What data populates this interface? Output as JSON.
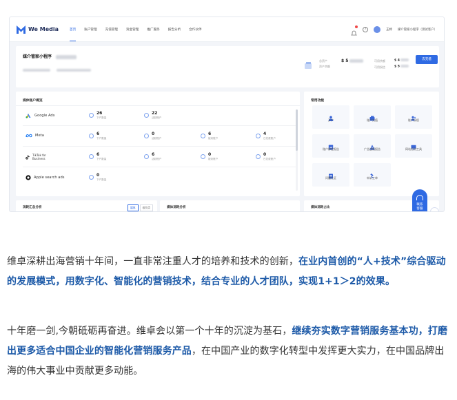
{
  "app": {
    "brand": "We Media",
    "nav": [
      "首页",
      "账户管理",
      "充值管理",
      "资金管理",
      "推广服务",
      "报告分析",
      "合作伙伴"
    ],
    "user_name": "王婷",
    "org_name": "媒介管家小程序（测试客户）"
  },
  "account": {
    "title": "媒介管家小程序",
    "recharge_label": "去充值",
    "balance_labels": [
      "总资产",
      "资产余额",
      "可用余额",
      "可用授信"
    ],
    "balance_values": [
      "$ 5",
      "$ 4",
      "$ 5"
    ]
  },
  "media_overview": {
    "title": "媒体账户概览",
    "rows": [
      {
        "platform": "Google Ads",
        "stats": [
          {
            "num": "26",
            "lbl": "下户数量"
          },
          {
            "num": "22",
            "lbl": "活跃账户"
          }
        ]
      },
      {
        "platform": "Meta",
        "stats": [
          {
            "num": "6",
            "lbl": "下户数量"
          },
          {
            "num": "0",
            "lbl": "活跃账户"
          },
          {
            "num": "6",
            "lbl": "被封账户"
          },
          {
            "num": "4",
            "lbl": "已花费账户"
          }
        ]
      },
      {
        "platform": "TikTok for Business",
        "stats": [
          {
            "num": "6",
            "lbl": "下户数量"
          },
          {
            "num": "6",
            "lbl": "活跃账户"
          },
          {
            "num": "0",
            "lbl": "被封账户"
          },
          {
            "num": "0",
            "lbl": "已花费账户"
          }
        ]
      },
      {
        "platform": "Apple search ads",
        "stats": [
          {
            "num": "0",
            "lbl": "下户数量"
          }
        ]
      }
    ]
  },
  "functions": {
    "title": "常用功能",
    "items": [
      "开户",
      "账户充值",
      "账户授权",
      "账户绑定报告",
      "广告违规报告",
      "网站检测工具",
      "问题社区",
      "申诉工单"
    ]
  },
  "bottom_panels": {
    "left_title": "消耗汇总分析",
    "left_tabs": [
      "媒体",
      "级别类"
    ],
    "mid_title": "媒体消耗分析",
    "right_title": "媒体消耗占比"
  },
  "service": {
    "label_top": "联系",
    "label_bottom": "客服"
  },
  "article": {
    "p1_a": "维卓深耕出海营销十年间，一直非常注重人才的培养和技术的创新，",
    "p1_b": "在业内首创的“人+技术”综合驱动的发展模式，用数字化、智能化的营销技术，结合专业的人才团队，实现1+1＞2的效果。",
    "p2_a": "十年磨一剑,今朝砥砺再奋进。维卓会以第一个十年的沉淀为基石，",
    "p2_b": "继续夯实数字营销服务基本功，打磨出更多适合中国企业的智能化营销服务产品",
    "p2_c": "，在中国产业的数字化转型中发挥更大实力，在中国品牌出海的伟大事业中贡献更多动能。"
  },
  "colors": {
    "accent": "#2f6ae3",
    "highlight_text": "#1d5aa8"
  }
}
